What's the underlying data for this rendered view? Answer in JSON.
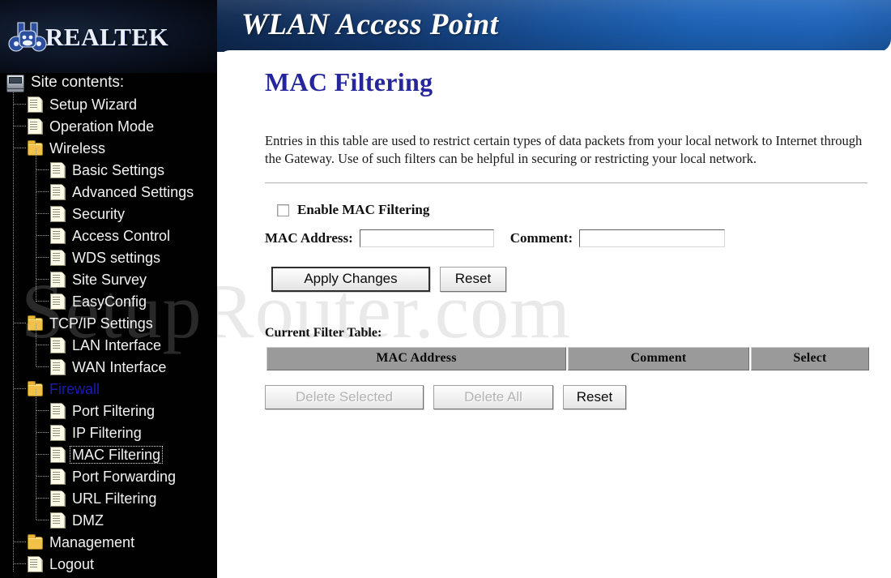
{
  "banner": {
    "title": "WLAN Access Point"
  },
  "brand": {
    "name": "REALTEK",
    "logo_icon": "realtek-mascot-icon"
  },
  "watermark": {
    "text": "SetupRouter.com",
    "part_dark": "Setup",
    "part_light": "Router.com"
  },
  "sidebar": {
    "root_label": "Site contents:",
    "root_icon": "computer-icon",
    "items": [
      {
        "label": "Setup Wizard",
        "level": 1,
        "icon": "document-icon",
        "state": "normal"
      },
      {
        "label": "Operation Mode",
        "level": 1,
        "icon": "document-icon",
        "state": "normal"
      },
      {
        "label": "Wireless",
        "level": 1,
        "icon": "folder-icon",
        "state": "normal"
      },
      {
        "label": "Basic Settings",
        "level": 2,
        "icon": "document-icon",
        "state": "normal"
      },
      {
        "label": "Advanced Settings",
        "level": 2,
        "icon": "document-icon",
        "state": "normal"
      },
      {
        "label": "Security",
        "level": 2,
        "icon": "document-icon",
        "state": "normal"
      },
      {
        "label": "Access Control",
        "level": 2,
        "icon": "document-icon",
        "state": "normal"
      },
      {
        "label": "WDS settings",
        "level": 2,
        "icon": "document-icon",
        "state": "normal"
      },
      {
        "label": "Site Survey",
        "level": 2,
        "icon": "document-icon",
        "state": "normal"
      },
      {
        "label": "EasyConfig",
        "level": 2,
        "icon": "document-icon",
        "state": "normal"
      },
      {
        "label": "TCP/IP Settings",
        "level": 1,
        "icon": "folder-icon",
        "state": "normal"
      },
      {
        "label": "LAN Interface",
        "level": 2,
        "icon": "document-icon",
        "state": "normal"
      },
      {
        "label": "WAN Interface",
        "level": 2,
        "icon": "document-icon",
        "state": "normal"
      },
      {
        "label": "Firewall",
        "level": 1,
        "icon": "folder-icon",
        "state": "visited"
      },
      {
        "label": "Port Filtering",
        "level": 2,
        "icon": "document-icon",
        "state": "normal"
      },
      {
        "label": "IP Filtering",
        "level": 2,
        "icon": "document-icon",
        "state": "normal"
      },
      {
        "label": "MAC Filtering",
        "level": 2,
        "icon": "document-icon",
        "state": "focused"
      },
      {
        "label": "Port Forwarding",
        "level": 2,
        "icon": "document-icon",
        "state": "normal"
      },
      {
        "label": "URL Filtering",
        "level": 2,
        "icon": "document-icon",
        "state": "normal"
      },
      {
        "label": "DMZ",
        "level": 2,
        "icon": "document-icon",
        "state": "normal"
      },
      {
        "label": "Management",
        "level": 1,
        "icon": "folder-icon",
        "state": "normal"
      },
      {
        "label": "Logout",
        "level": 1,
        "icon": "document-icon",
        "state": "normal"
      }
    ]
  },
  "main": {
    "title": "MAC Filtering",
    "description": "Entries in this table are used to restrict certain types of data packets from your local network to Internet through the Gateway. Use of such filters can be helpful in securing or restricting your local network.",
    "enable_label": "Enable MAC Filtering",
    "enable_checked": false,
    "mac_label": "MAC Address:",
    "mac_value": "",
    "mac_placeholder": "",
    "comment_label": "Comment:",
    "comment_value": "",
    "comment_placeholder": "",
    "apply_label": "Apply Changes",
    "reset_label": "Reset",
    "table_label": "Current Filter Table:",
    "table": {
      "columns": [
        "MAC Address",
        "Comment",
        "Select"
      ],
      "rows": []
    },
    "delete_selected_label": "Delete Selected",
    "delete_selected_disabled": true,
    "delete_all_label": "Delete All",
    "delete_all_disabled": true,
    "reset_table_label": "Reset",
    "reset_table_disabled": false
  },
  "colors": {
    "banner_left": "#0c1a2e",
    "banner_right": "#1f66bd",
    "sidebar_bg": "#010101",
    "heading": "#26269c",
    "visited_link": "#1b1bb0",
    "table_header_bg": "#9a9a9a",
    "folder_icon": "#f2c14a"
  }
}
